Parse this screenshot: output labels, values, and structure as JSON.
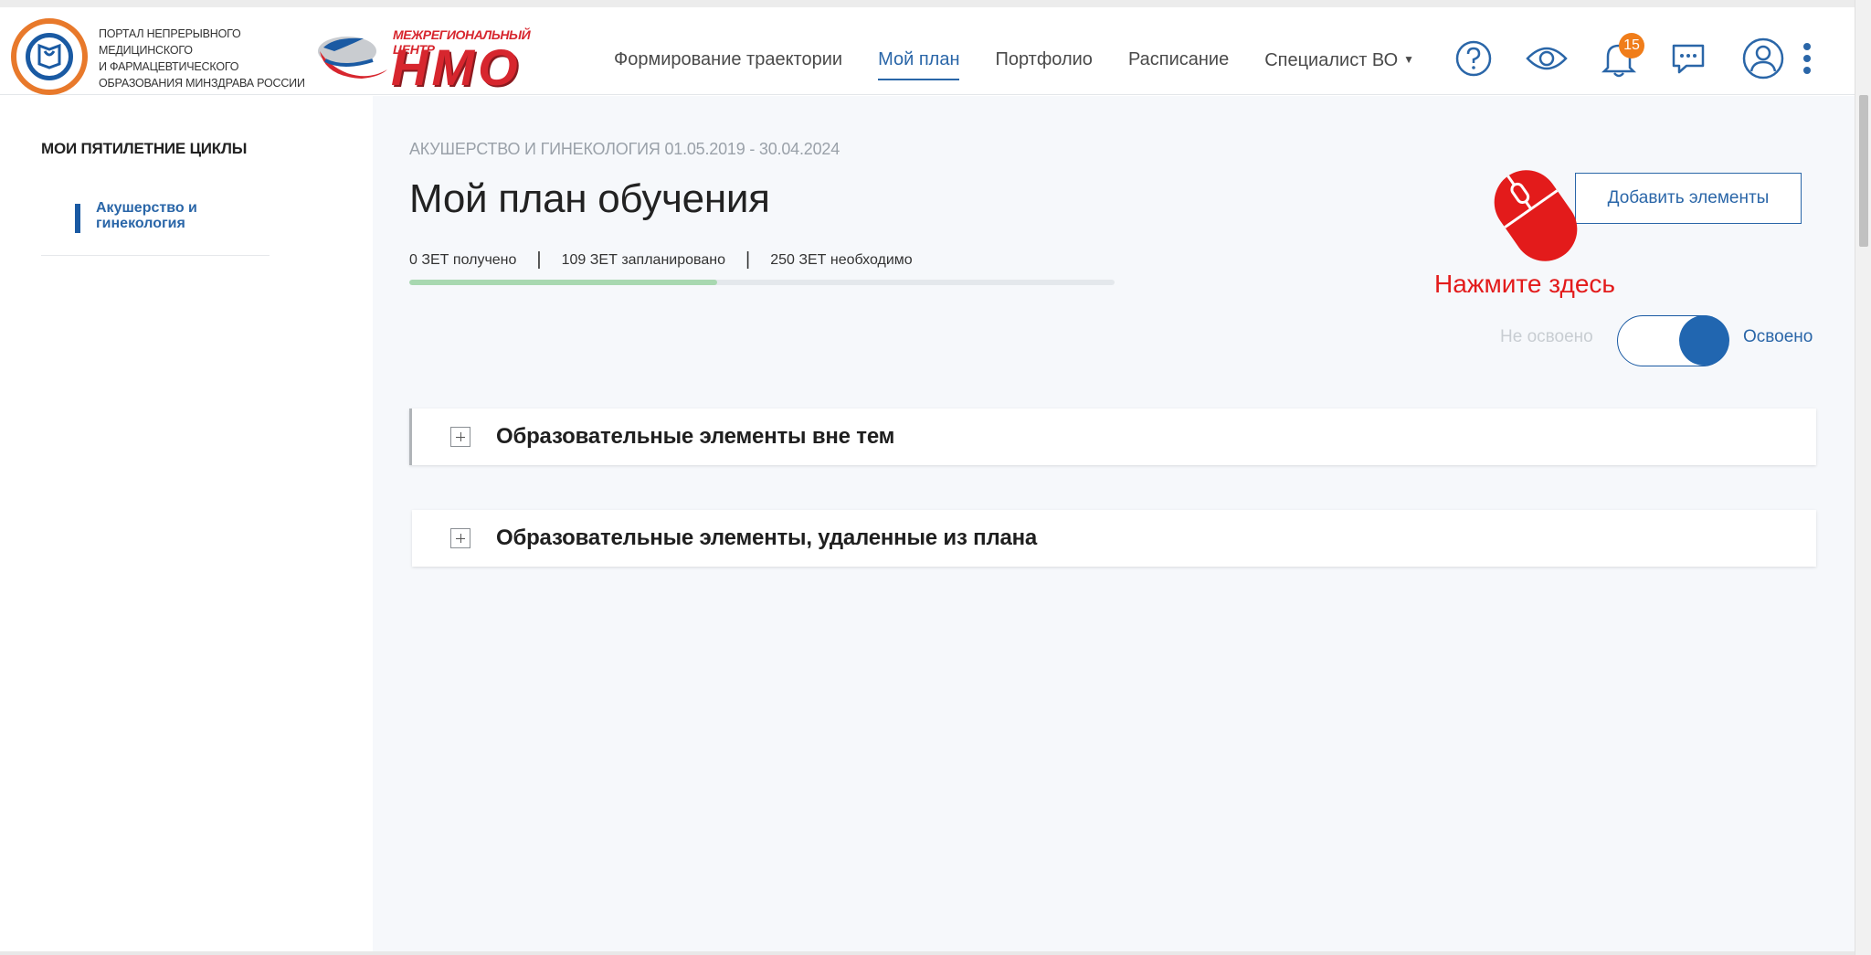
{
  "header": {
    "portal_text_lines": [
      "ПОРТАЛ НЕПРЕРЫВНОГО",
      "МЕДИЦИНСКОГО",
      "И ФАРМАЦЕВТИЧЕСКОГО",
      "ОБРАЗОВАНИЯ МИНЗДРАВА РОССИИ"
    ],
    "nmo_subtitle": "МЕЖРЕГИОНАЛЬНЫЙ ЦЕНТР",
    "nmo_title": "НМО",
    "nav": [
      {
        "label": "Формирование траектории",
        "active": false
      },
      {
        "label": "Мой план",
        "active": true
      },
      {
        "label": "Портфолио",
        "active": false
      },
      {
        "label": "Расписание",
        "active": false
      },
      {
        "label": "Специалист ВО",
        "active": false
      }
    ],
    "notification_count": "15",
    "icons": [
      "help-icon",
      "eye-icon",
      "bell-icon",
      "chat-icon",
      "user-icon",
      "more-vertical-icon"
    ]
  },
  "sidebar": {
    "title": "МОИ ПЯТИЛЕТНИЕ ЦИКЛЫ",
    "items": [
      {
        "label": "Акушерство и гинекология"
      }
    ]
  },
  "main": {
    "breadcrumb": "АКУШЕРСТВО И ГИНЕКОЛОГИЯ 01.05.2019 - 30.04.2024",
    "title": "Мой план обучения",
    "stats": {
      "received": "0 ЗЕТ получено",
      "planned": "109 ЗЕТ запланировано",
      "required": "250 ЗЕТ необходимо"
    },
    "progress_percent": 43.6,
    "add_button": "Добавить элементы",
    "click_hint": "Нажмите здесь",
    "toggle": {
      "off_label": "Не освоено",
      "on_label": "Освоено",
      "state": "on"
    },
    "panels": [
      {
        "title": "Образовательные элементы вне тем"
      },
      {
        "title": "Образовательные элементы, удаленные из плана"
      }
    ]
  },
  "colors": {
    "brand_blue": "#2a66a8",
    "brand_red": "#d7262e",
    "badge_orange": "#f07d1a",
    "hint_red": "#e31b1b"
  }
}
